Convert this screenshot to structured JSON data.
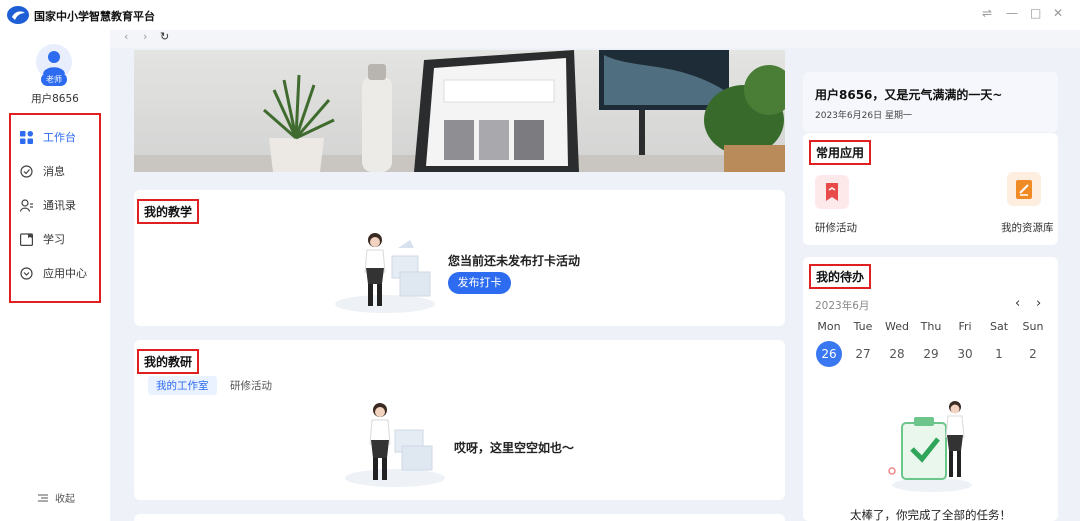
{
  "window": {
    "title": "国家中小学智慧教育平台",
    "controls": [
      "⇌",
      "—",
      "□",
      "✕"
    ]
  },
  "sidebar": {
    "badge": "老师",
    "username": "用户8656",
    "items": [
      {
        "label": "工作台",
        "icon": "grid-icon",
        "active": true
      },
      {
        "label": "消息",
        "icon": "message-check-icon",
        "active": false
      },
      {
        "label": "通讯录",
        "icon": "contacts-icon",
        "active": false
      },
      {
        "label": "学习",
        "icon": "study-icon",
        "active": false
      },
      {
        "label": "应用中心",
        "icon": "app-center-icon",
        "active": false
      }
    ],
    "collapse_label": "收起"
  },
  "nav": {
    "back": "‹",
    "forward": "›",
    "refresh": "↻"
  },
  "teaching": {
    "title": "我的教学",
    "empty_text": "您当前还未发布打卡活动",
    "button": "发布打卡"
  },
  "research": {
    "title": "我的教研",
    "tabs": [
      "我的工作室",
      "研修活动"
    ],
    "empty_text": "哎呀，这里空空如也～"
  },
  "greeting": {
    "text": "用户8656，又是元气满满的一天~",
    "date": "2023年6月26日  星期一"
  },
  "common_apps": {
    "title": "常用应用",
    "apps": [
      {
        "label": "研修活动",
        "color": "#e94b4b"
      },
      {
        "label": "我的资源库",
        "color": "#f08a24"
      }
    ]
  },
  "todo": {
    "title": "我的待办",
    "month": "2023年6月",
    "prev": "‹",
    "next": "›",
    "weekdays": [
      "Mon",
      "Tue",
      "Wed",
      "Thu",
      "Fri",
      "Sat",
      "Sun"
    ],
    "days": [
      "26",
      "27",
      "28",
      "29",
      "30",
      "1",
      "2"
    ],
    "today_index": 0,
    "done_text": "太棒了，你完成了全部的任务！"
  },
  "colors": {
    "accent": "#2d6cf0",
    "highlight_box": "#e02020"
  }
}
